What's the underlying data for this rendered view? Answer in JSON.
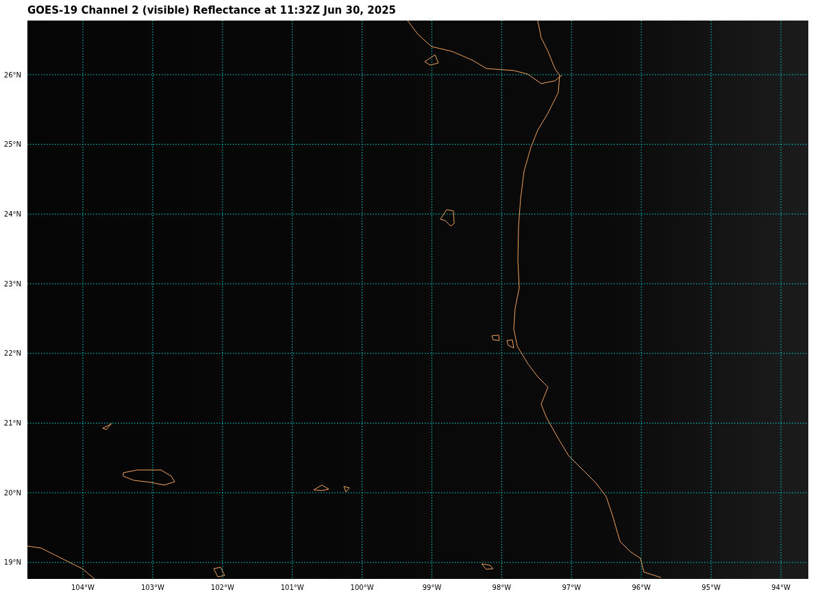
{
  "title": "GOES-19 Channel 2 (visible) Reflectance at 11:32Z Jun 30, 2025",
  "map": {
    "lat_labels": [
      "26°N",
      "25°N",
      "24°N",
      "23°N",
      "22°N",
      "21°N",
      "20°N",
      "19°N"
    ],
    "lon_labels": [
      "104°W",
      "103°W",
      "102°W",
      "101°W",
      "100°W",
      "99°W",
      "98°W",
      "97°W",
      "96°W",
      "95°W",
      "94°W"
    ]
  }
}
